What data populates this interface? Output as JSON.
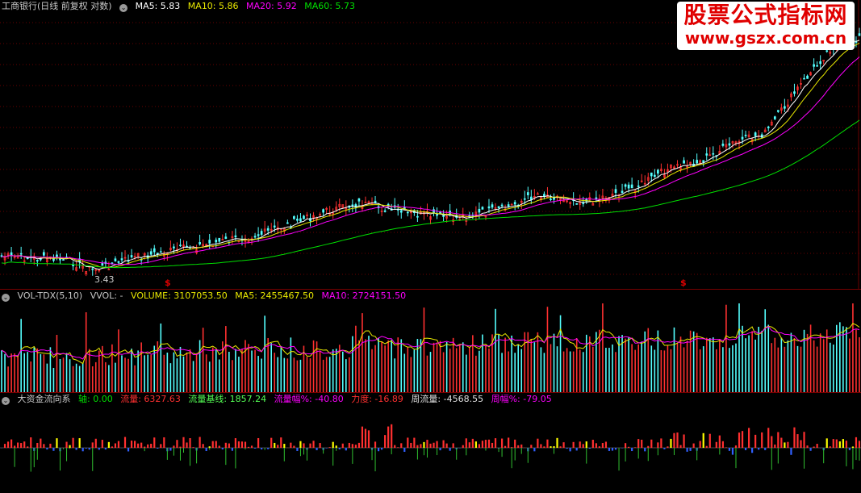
{
  "price": {
    "title": "工商银行(日线 前复权 对数)",
    "ma5": "MA5: 5.83",
    "ma10": "MA10: 5.86",
    "ma20": "MA20: 5.92",
    "ma60": "MA60: 5.73",
    "low_label": "3.43",
    "marker_1": "$",
    "marker_2": "$",
    "colors": {
      "ma5": "#ffffff",
      "ma10": "#e8e800",
      "ma20": "#ff00ff",
      "ma60": "#00e000",
      "up": "#ff3030",
      "down": "#54ffff"
    }
  },
  "volume": {
    "title": "VOL-TDX(5,10)",
    "vvol": "VVOL: -",
    "volume": "VOLUME: 3107053.50",
    "ma5": "MA5: 2455467.50",
    "ma10": "MA10: 2724151.50"
  },
  "flow": {
    "title": "大资金流向系",
    "axis": "轴: 0.00",
    "flow": "流量: 6327.63",
    "baseline": "流量基线: 1857.24",
    "amp": "流量幅%: -40.80",
    "force": "力度: -16.89",
    "week_flow": "周流量: -4568.55",
    "week_amp": "周幅%: -79.05"
  },
  "watermark": {
    "title": "股票公式指标网",
    "url": "www.gszx.com.cn"
  }
}
